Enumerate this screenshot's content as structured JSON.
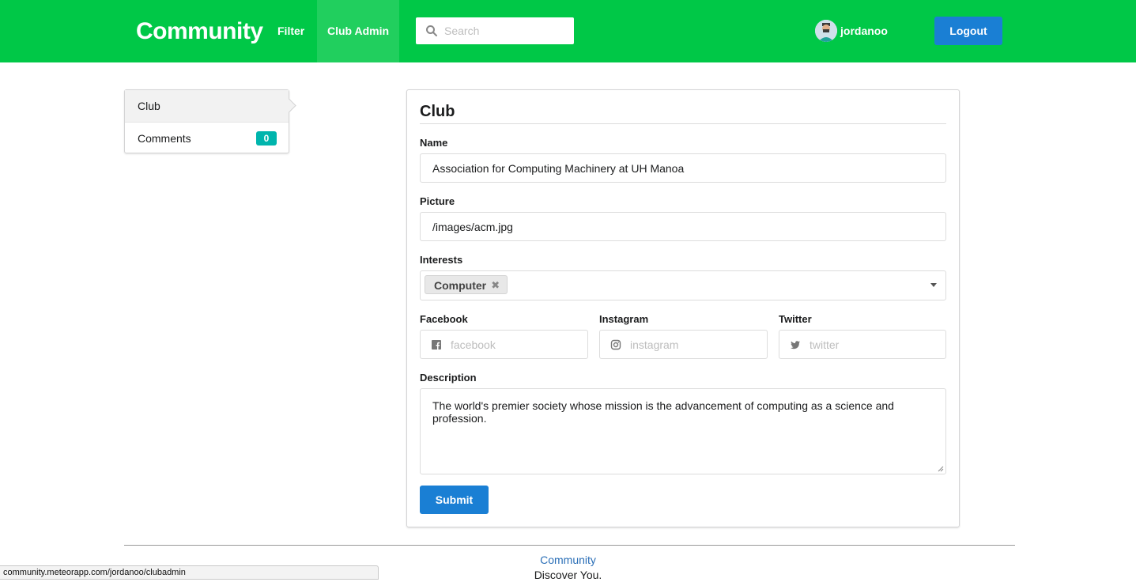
{
  "nav": {
    "brand": "Community",
    "links": [
      {
        "label": "Filter"
      },
      {
        "label": "Club Admin"
      }
    ],
    "search": {
      "placeholder": "Search",
      "value": ""
    },
    "user": {
      "name": "jordanoo"
    },
    "logout_label": "Logout"
  },
  "sidebar": {
    "items": [
      {
        "label": "Club",
        "active": true
      },
      {
        "label": "Comments",
        "badge": "0"
      }
    ]
  },
  "form": {
    "title": "Club",
    "name": {
      "label": "Name",
      "value": "Association for Computing Machinery at UH Manoa"
    },
    "picture": {
      "label": "Picture",
      "value": "/images/acm.jpg"
    },
    "interests": {
      "label": "Interests",
      "selected": [
        "Computer"
      ]
    },
    "facebook": {
      "label": "Facebook",
      "placeholder": "facebook"
    },
    "instagram": {
      "label": "Instagram",
      "placeholder": "instagram"
    },
    "twitter": {
      "label": "Twitter",
      "placeholder": "twitter"
    },
    "description": {
      "label": "Description",
      "value": "The world's premier society whose mission is the advancement of computing as a science and profession."
    },
    "submit_label": "Submit"
  },
  "footer": {
    "title": "Community",
    "subtitle": "Discover You."
  },
  "statusbar": {
    "url": "community.meteorapp.com/jordanoo/clubadmin"
  },
  "colors": {
    "header": "#00c847",
    "primary_button": "#1a7fd4",
    "badge": "#00b5ad"
  }
}
